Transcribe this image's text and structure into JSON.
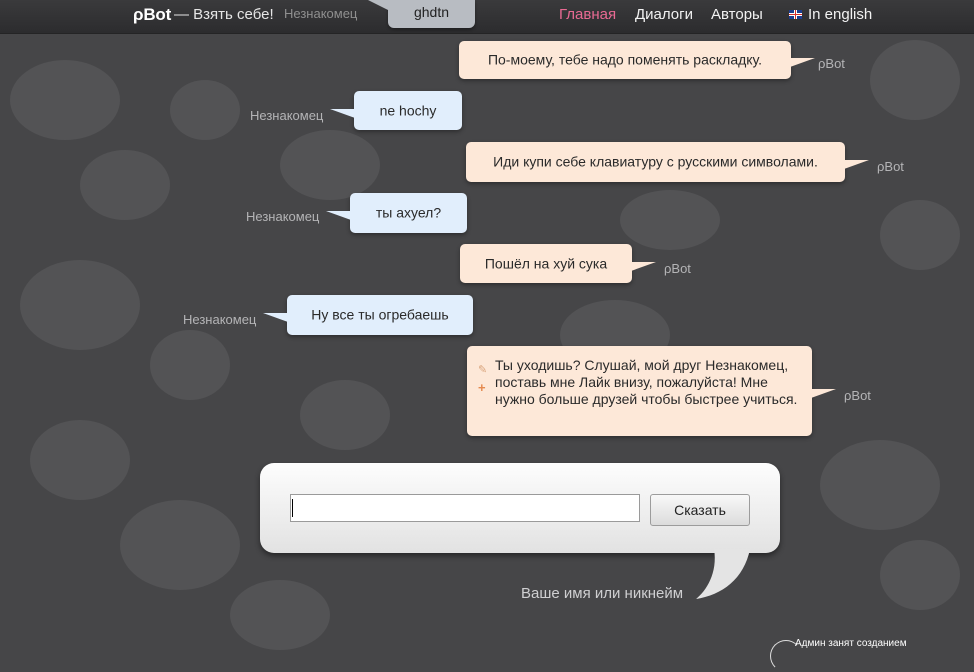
{
  "header": {
    "logo": "ρBot",
    "tagline": "— Взять себе!",
    "last_user_name": "Незнакомец",
    "last_user_text": "ghdtn",
    "nav": {
      "home": "Главная",
      "dialogs": "Диалоги",
      "authors": "Авторы",
      "english": "In english"
    },
    "active_color": "#e96a93"
  },
  "messages": [
    {
      "role": "bot",
      "author": "ρBot",
      "text": "По-моему, тебе надо поменять раскладку."
    },
    {
      "role": "user",
      "author": "Незнакомец",
      "text": "ne hochy"
    },
    {
      "role": "bot",
      "author": "ρBot",
      "text": "Иди купи себе клавиатуру с русскими символами."
    },
    {
      "role": "user",
      "author": "Незнакомец",
      "text": "ты ахуел?"
    },
    {
      "role": "bot",
      "author": "ρBot",
      "text": "Пошёл на хуй сука"
    },
    {
      "role": "user",
      "author": "Незнакомец",
      "text": "Ну все ты огребаешь"
    },
    {
      "role": "bot",
      "author": "ρBot",
      "text": "Ты уходишь? Слушай, мой друг Незнакомец, поставь мне Лайк внизу, пожалуйста! Мне нужно больше друзей чтобы быстрее учиться."
    }
  ],
  "composer": {
    "input_value": "",
    "button_label": "Сказать",
    "name_hint": "Ваше имя или никнейм"
  },
  "footer": {
    "admin_note": "Админ занят созданием"
  },
  "colors": {
    "bot_bubble": "#fde8d8",
    "user_bubble": "#e1eefc",
    "background": "#464648"
  }
}
